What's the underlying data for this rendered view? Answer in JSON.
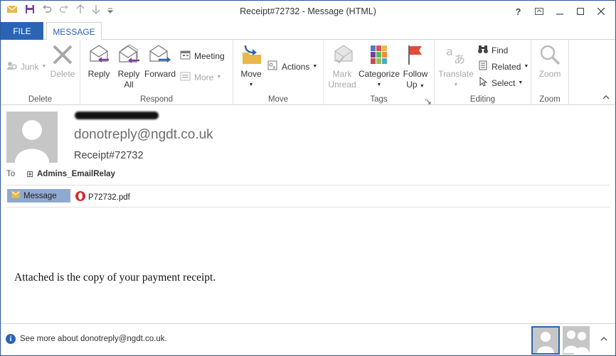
{
  "window": {
    "title": "Receipt#72732 - Message (HTML)",
    "help_label": "?"
  },
  "tabs": {
    "file": "FILE",
    "message": "MESSAGE"
  },
  "ribbon": {
    "delete_group": {
      "label": "Delete",
      "junk": "Junk",
      "delete": "Delete"
    },
    "respond_group": {
      "label": "Respond",
      "reply": "Reply",
      "reply_all_line1": "Reply",
      "reply_all_line2": "All",
      "forward": "Forward",
      "meeting": "Meeting",
      "more": "More"
    },
    "move_group": {
      "label": "Move",
      "move": "Move",
      "actions": "Actions"
    },
    "tags_group": {
      "label": "Tags",
      "mark_unread_line1": "Mark",
      "mark_unread_line2": "Unread",
      "categorize": "Categorize",
      "follow_up_line1": "Follow",
      "follow_up_line2": "Up"
    },
    "editing_group": {
      "label": "Editing",
      "translate": "Translate",
      "find": "Find",
      "related": "Related",
      "select": "Select"
    },
    "zoom_group": {
      "label": "Zoom",
      "zoom": "Zoom"
    }
  },
  "message": {
    "sender": "donotreply@ngdt.co.uk",
    "subject": "Receipt#72732",
    "to_label": "To",
    "to_expand": "⊞",
    "to_value": "Admins_EmailRelay",
    "message_tab": "Message",
    "attachment": "P72732.pdf",
    "body": "Attached is the copy of your payment receipt."
  },
  "people_pane": {
    "see_more": "See more about donotreply@ngdt.co.uk."
  },
  "colors": {
    "accent": "#2b64b4",
    "message_tab_bg": "#8fa9cf"
  }
}
